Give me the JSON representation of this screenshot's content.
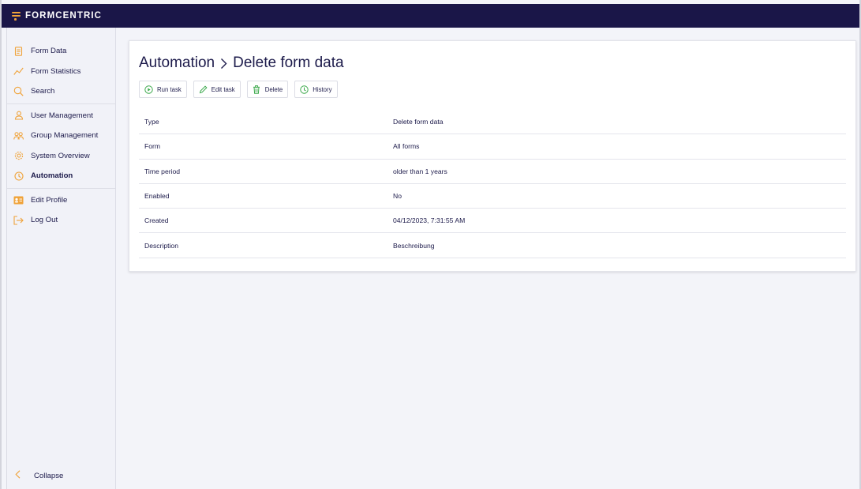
{
  "app": {
    "brand": "FORMCENTRIC"
  },
  "sidebar": {
    "groups": [
      [
        {
          "label": "Form Data",
          "icon": "form-data-icon"
        },
        {
          "label": "Form Statistics",
          "icon": "statistics-icon"
        },
        {
          "label": "Search",
          "icon": "search-icon"
        }
      ],
      [
        {
          "label": "User Management",
          "icon": "user-icon"
        },
        {
          "label": "Group Management",
          "icon": "group-icon"
        },
        {
          "label": "System Overview",
          "icon": "gear-icon"
        },
        {
          "label": "Automation",
          "icon": "clock-icon",
          "active": true
        }
      ],
      [
        {
          "label": "Edit Profile",
          "icon": "profile-card-icon"
        },
        {
          "label": "Log Out",
          "icon": "logout-icon"
        }
      ]
    ],
    "collapse_label": "Collapse"
  },
  "breadcrumb": {
    "parent": "Automation",
    "current": "Delete form data"
  },
  "toolbar": {
    "run": "Run task",
    "edit": "Edit task",
    "delete": "Delete",
    "history": "History"
  },
  "details": [
    {
      "label": "Type",
      "value": "Delete form data"
    },
    {
      "label": "Form",
      "value": "All forms"
    },
    {
      "label": "Time period",
      "value": "older than 1 years"
    },
    {
      "label": "Enabled",
      "value": "No"
    },
    {
      "label": "Created",
      "value": "04/12/2023, 7:31:55 AM"
    },
    {
      "label": "Description",
      "value": "Beschreibung"
    }
  ],
  "colors": {
    "accent": "#f0a33a",
    "topbar": "#1a1648",
    "button_icon": "#3aa84a"
  }
}
